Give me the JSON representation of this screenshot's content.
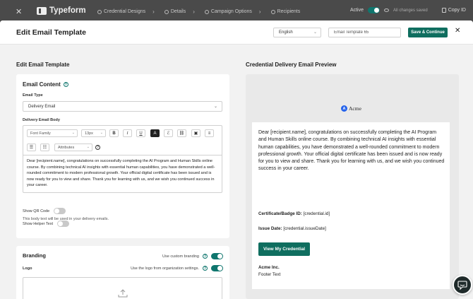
{
  "app": {
    "logo_text": "Typeform",
    "steps": [
      {
        "label": "Credential Designs"
      },
      {
        "label": "Details"
      },
      {
        "label": "Campaign Options"
      },
      {
        "label": "Recipients"
      }
    ],
    "active_label": "Active",
    "saved_status": "All changes saved",
    "copy_label": "Copy ID"
  },
  "modal": {
    "title": "Edit Email Template",
    "language": "English",
    "template_name": "Email Template 65",
    "save_label": "Save & Continue"
  },
  "left": {
    "section_title": "Edit Email Template",
    "content_title": "Email Content",
    "email_type_label": "Email Type",
    "email_type_value": "Delivery Email",
    "body_label": "Delivery Email Body",
    "font_family": "Font Family",
    "font_size": "13px",
    "attributes": "Attributes",
    "body_text": "Dear [recipient.name], congratulations on successfully completing the AI Program and Human Skills online course. By combining technical AI insights with essential human capabilities, you have demonstrated a well-rounded commitment to modern professional growth. Your official digital certificate has been issued and is now ready for you to view and share. Thank you for learning with us, and we wish you continued success in your career.",
    "hint": "This body text will be used in your delivery emails.",
    "show_qr_label": "Show QR Code",
    "show_helper_label": "Show Helper Text"
  },
  "branding": {
    "title": "Branding",
    "custom_branding_label": "Use custom branding",
    "org_logo_label": "Use the logo from organization settings.",
    "logo_label": "Logo"
  },
  "preview": {
    "section_title": "Credential Delivery Email Preview",
    "brand_initial": "A",
    "brand_name": "Acme",
    "body_text": "Dear [recipient.name], congratulations on successfully completing the AI Program and Human Skills online course. By combining technical AI insights with essential human capabilities, you have demonstrated a well-rounded commitment to modern professional growth. Your official digital certificate has been issued and is now ready for you to view and share. Thank you for learning with us, and we wish you continued success in your career.",
    "cert_id_label": "Certificate/Badge ID:",
    "cert_id_value": "[credential.id]",
    "issue_date_label": "Issue Date:",
    "issue_date_value": "[credential.issueDate]",
    "button_label": "View My Credential",
    "company": "Acme Inc.",
    "footer": "Footer Text"
  },
  "colors": {
    "accent": "#0f6e5f",
    "brand_mark": "#2563eb"
  }
}
